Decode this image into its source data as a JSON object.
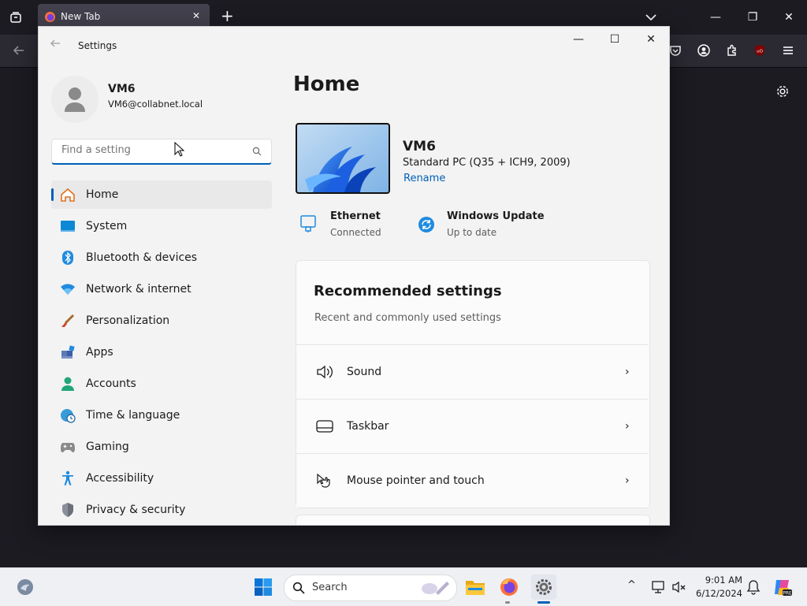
{
  "browser": {
    "tab_title": "New Tab",
    "tab_close": "✕",
    "new_tab": "+",
    "controls": {
      "minimize": "—",
      "restore": "❐",
      "close": "✕"
    }
  },
  "settings": {
    "window_title": "Settings",
    "controls": {
      "minimize": "—",
      "maximize": "☐",
      "close": "✕"
    },
    "user": {
      "name": "VM6",
      "email": "VM6@collabnet.local"
    },
    "search_placeholder": "Find a setting",
    "nav": [
      {
        "label": "Home",
        "icon": "home-icon",
        "active": true
      },
      {
        "label": "System",
        "icon": "system-icon"
      },
      {
        "label": "Bluetooth & devices",
        "icon": "bluetooth-icon"
      },
      {
        "label": "Network & internet",
        "icon": "wifi-icon"
      },
      {
        "label": "Personalization",
        "icon": "brush-icon"
      },
      {
        "label": "Apps",
        "icon": "apps-icon"
      },
      {
        "label": "Accounts",
        "icon": "accounts-icon"
      },
      {
        "label": "Time & language",
        "icon": "globe-clock-icon"
      },
      {
        "label": "Gaming",
        "icon": "gamepad-icon"
      },
      {
        "label": "Accessibility",
        "icon": "accessibility-icon"
      },
      {
        "label": "Privacy & security",
        "icon": "shield-icon"
      }
    ],
    "home": {
      "title": "Home",
      "device": {
        "name": "VM6",
        "model": "Standard PC (Q35 + ICH9, 2009)",
        "rename": "Rename"
      },
      "status": [
        {
          "title": "Ethernet",
          "sub": "Connected",
          "icon": "ethernet-icon"
        },
        {
          "title": "Windows Update",
          "sub": "Up to date",
          "icon": "windows-update-icon"
        }
      ],
      "recommended": {
        "title": "Recommended settings",
        "subtitle": "Recent and commonly used settings",
        "items": [
          {
            "label": "Sound",
            "icon": "speaker-icon"
          },
          {
            "label": "Taskbar",
            "icon": "taskbar-icon"
          },
          {
            "label": "Mouse pointer and touch",
            "icon": "pointer-touch-icon"
          }
        ]
      }
    }
  },
  "taskbar": {
    "search_placeholder": "Search",
    "clock": {
      "time": "9:01 AM",
      "date": "6/12/2024"
    },
    "chevron": "^"
  },
  "colors": {
    "accent": "#005fb8",
    "firefox_dark": "#1c1b22",
    "settings_bg": "#f3f3f3"
  }
}
